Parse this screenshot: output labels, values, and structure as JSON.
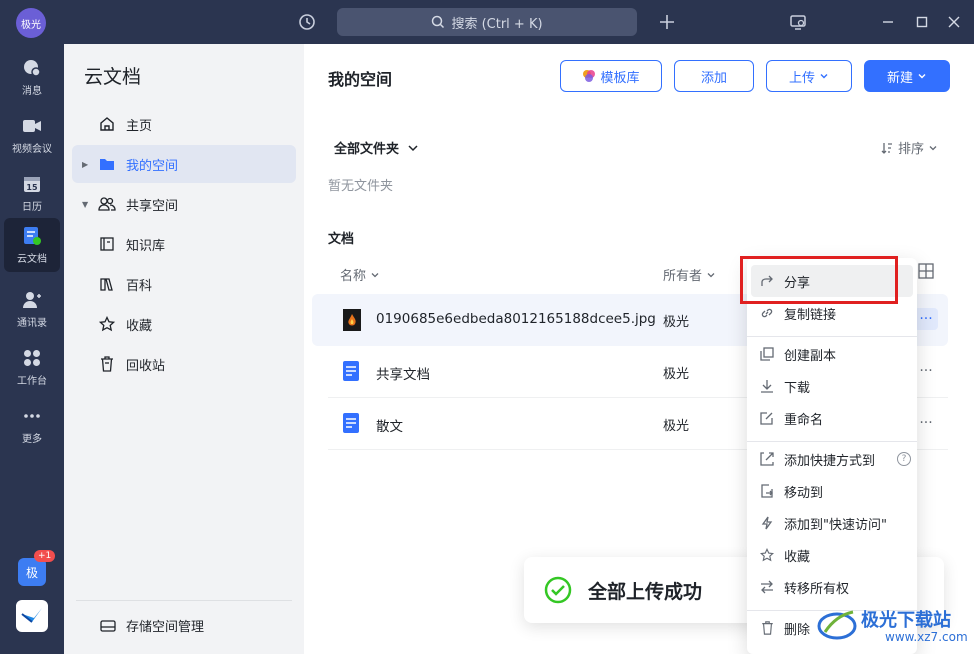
{
  "topbar": {
    "user_avatar": "极光",
    "search_placeholder": "搜索 (Ctrl + K)"
  },
  "rail": {
    "items": [
      {
        "label": "消息",
        "icon": "message-icon"
      },
      {
        "label": "视频会议",
        "icon": "video-icon"
      },
      {
        "label": "日历",
        "icon": "calendar-icon"
      },
      {
        "label": "云文档",
        "icon": "cloud-doc-icon"
      },
      {
        "label": "通讯录",
        "icon": "contacts-icon"
      },
      {
        "label": "工作台",
        "icon": "workbench-icon"
      },
      {
        "label": "更多",
        "icon": "more-icon"
      }
    ],
    "calendar_day": "15",
    "bottom_avatar": "极",
    "badge": "+1"
  },
  "sidebar": {
    "title": "云文档",
    "items": [
      {
        "label": "主页"
      },
      {
        "label": "我的空间"
      },
      {
        "label": "共享空间"
      },
      {
        "label": "知识库"
      },
      {
        "label": "百科"
      },
      {
        "label": "收藏"
      },
      {
        "label": "回收站"
      }
    ],
    "storage_label": "存储空间管理"
  },
  "main": {
    "title": "我的空间",
    "buttons": {
      "template": "模板库",
      "add": "添加",
      "upload": "上传",
      "new": "新建"
    },
    "folder_header": "全部文件夹",
    "sort_label": "排序",
    "empty_folder": "暂无文件夹",
    "docs_header": "文档",
    "columns": {
      "name": "名称",
      "owner": "所有者"
    },
    "rows": [
      {
        "name": "0190685e6edbeda8012165188dcee5.jpg",
        "owner": "极光"
      },
      {
        "name": "共享文档",
        "owner": "极光"
      },
      {
        "name": "散文",
        "owner": "极光"
      }
    ]
  },
  "toast": {
    "text": "全部上传成功"
  },
  "context_menu": {
    "items": [
      {
        "label": "分享",
        "icon": "share-icon"
      },
      {
        "label": "复制链接",
        "icon": "link-icon"
      },
      {
        "label": "创建副本",
        "icon": "copy-icon"
      },
      {
        "label": "下载",
        "icon": "download-icon"
      },
      {
        "label": "重命名",
        "icon": "rename-icon"
      },
      {
        "label": "添加快捷方式到",
        "icon": "shortcut-icon"
      },
      {
        "label": "移动到",
        "icon": "move-icon"
      },
      {
        "label": "添加到\"快速访问\"",
        "icon": "bolt-icon"
      },
      {
        "label": "收藏",
        "icon": "star-icon"
      },
      {
        "label": "转移所有权",
        "icon": "transfer-icon"
      },
      {
        "label": "删除",
        "icon": "trash-icon"
      }
    ],
    "help": "?"
  },
  "watermark": {
    "text": "极光下载站",
    "url": "www.xz7.com"
  },
  "colors": {
    "accent": "#3370ff",
    "rail_bg": "#2b3550",
    "highlight_box": "#e02020",
    "success": "#34c724"
  }
}
